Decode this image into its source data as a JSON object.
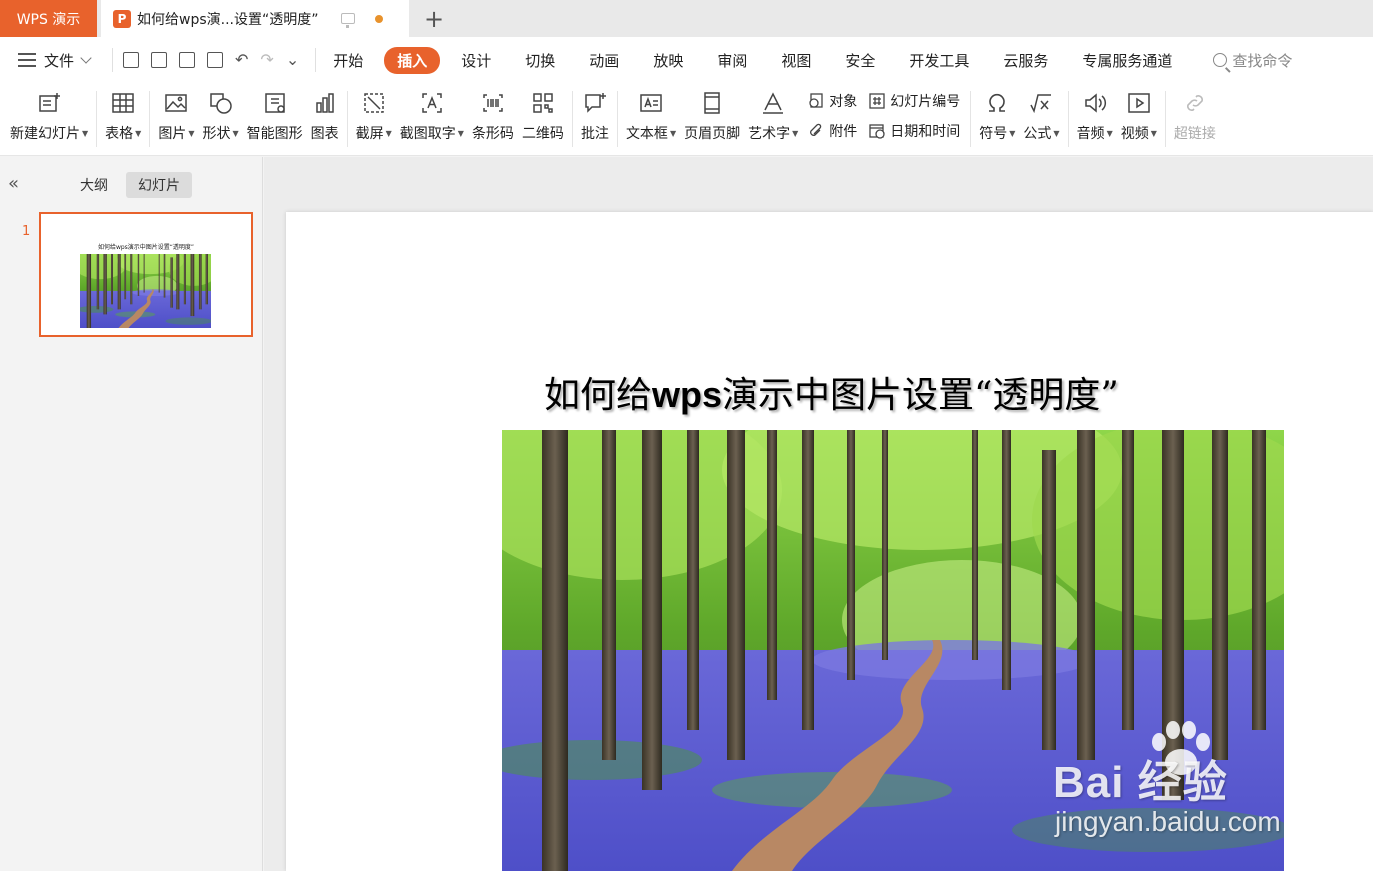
{
  "titlebar": {
    "app_tab": "WPS 演示",
    "doc_tab_icon": "P",
    "doc_tab_title": "如何给wps演...设置“透明度”",
    "new_tab": "+"
  },
  "menubar": {
    "file_label": "文件",
    "items": [
      "开始",
      "插入",
      "设计",
      "切换",
      "动画",
      "放映",
      "审阅",
      "视图",
      "安全",
      "开发工具",
      "云服务",
      "专属服务通道"
    ],
    "active_item": "插入",
    "search_placeholder": "查找命令"
  },
  "ribbon": {
    "new_slide": "新建幻灯片",
    "table": "表格",
    "picture": "图片",
    "shape": "形状",
    "smart_graphic": "智能图形",
    "chart": "图表",
    "screenshot": "截屏",
    "ocr": "截图取字",
    "barcode": "条形码",
    "qrcode": "二维码",
    "comment": "批注",
    "textbox": "文本框",
    "header_footer": "页眉页脚",
    "wordart": "艺术字",
    "object": "对象",
    "attachment": "附件",
    "slide_number": "幻灯片编号",
    "datetime": "日期和时间",
    "symbol": "符号",
    "formula": "公式",
    "audio": "音频",
    "video": "视频",
    "hyperlink": "超链接"
  },
  "panel": {
    "collapse": "«",
    "tab_outline": "大纲",
    "tab_slides": "幻灯片",
    "slide_number": "1",
    "thumb_title": "如何给wps演示中图片设置“透明度”"
  },
  "slide": {
    "title_pre": "如何给",
    "title_bold": "wps",
    "title_post": "演示中图片设置“透明度”"
  },
  "watermark": {
    "main": "Bai  经验",
    "sub": "jingyan.baidu.com"
  },
  "colors": {
    "accent": "#e8622c",
    "bluebell": "#5a5fd6",
    "foliage": "#7cc832"
  }
}
